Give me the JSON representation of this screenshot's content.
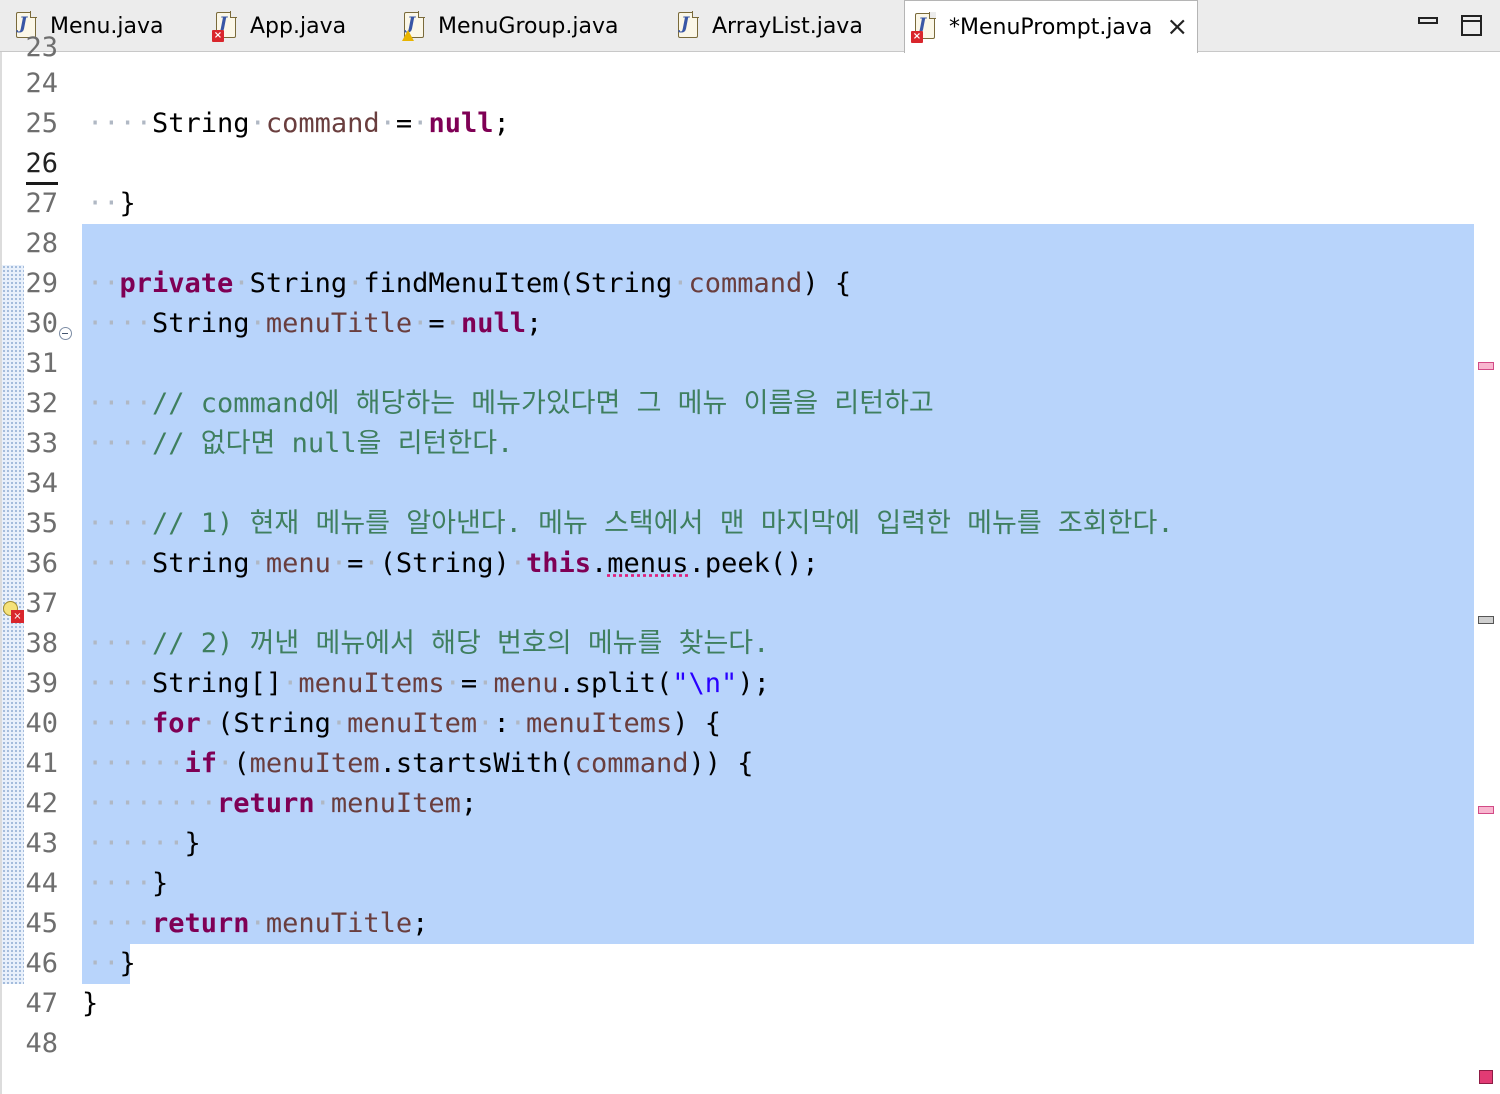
{
  "tabs": [
    {
      "label": "Menu.java",
      "status": "none",
      "active": false
    },
    {
      "label": "App.java",
      "status": "error",
      "active": false
    },
    {
      "label": "MenuGroup.java",
      "status": "warning",
      "active": false
    },
    {
      "label": "ArrayList.java",
      "status": "none",
      "active": false
    },
    {
      "label": "*MenuPrompt.java",
      "status": "error",
      "active": true
    }
  ],
  "window_controls": {
    "minimize_icon": "minimize-icon",
    "maximize_icon": "maximize-icon",
    "close_tab_glyph": "×"
  },
  "editor": {
    "current_line": "26",
    "lines": [
      {
        "n": "23",
        "partial": true
      },
      {
        "n": "24"
      },
      {
        "n": "25"
      },
      {
        "n": "26"
      },
      {
        "n": "27"
      },
      {
        "n": "28"
      },
      {
        "n": "29"
      },
      {
        "n": "30"
      },
      {
        "n": "31"
      },
      {
        "n": "32"
      },
      {
        "n": "33"
      },
      {
        "n": "34"
      },
      {
        "n": "35"
      },
      {
        "n": "36"
      },
      {
        "n": "37"
      },
      {
        "n": "38"
      },
      {
        "n": "39"
      },
      {
        "n": "40"
      },
      {
        "n": "41"
      },
      {
        "n": "42"
      },
      {
        "n": "43"
      },
      {
        "n": "44"
      },
      {
        "n": "45"
      },
      {
        "n": "46"
      },
      {
        "n": "47"
      },
      {
        "n": "48"
      }
    ],
    "code": {
      "l25": {
        "type": "String",
        "name": "command",
        "op": "=",
        "kw": "null",
        "end": ";"
      },
      "l27": "}",
      "l29": {
        "kw": "private",
        "type": "String",
        "method": "findMenuItem(String",
        "param": "command",
        "end": ") {"
      },
      "l30": {
        "type": "String",
        "name": "menuTitle",
        "op": "=",
        "kw": "null",
        "end": ";"
      },
      "l32": "// command에 해당하는 메뉴가있다면 그 메뉴 이름을 리턴하고",
      "l33": "// 없다면 null을 리턴한다.",
      "l35": "// 1) 현재 메뉴를 알아낸다. 메뉴 스택에서 맨 마지막에 입력한 메뉴를 조회한다.",
      "l36": {
        "type": "String",
        "name": "menu",
        "op": "=",
        "cast": "(String)",
        "kw": "this",
        "field": "menus",
        "call": ".peek();"
      },
      "l38": "// 2) 꺼낸 메뉴에서 해당 번호의 메뉴를 찾는다.",
      "l39": {
        "type": "String[]",
        "name": "menuItems",
        "op": "=",
        "recv": "menu",
        "call": ".split(",
        "str": "\"\\n\"",
        "end": ");"
      },
      "l40": {
        "kw": "for",
        "open": "(String",
        "name": "menuItem",
        "sep": ":",
        "iter": "menuItems",
        "end": ") {"
      },
      "l41": {
        "kw": "if",
        "open": "(",
        "recv": "menuItem",
        "call": ".startsWith(",
        "arg": "command",
        "end": ")) {"
      },
      "l42": {
        "kw": "return",
        "name": "menuItem",
        "end": ";"
      },
      "l43": "}",
      "l44": "}",
      "l45": {
        "kw": "return",
        "name": "menuTitle",
        "end": ";"
      },
      "l46": "}",
      "l47": "}"
    }
  },
  "colors": {
    "keyword": "#7f0055",
    "local_var": "#6a3e3e",
    "comment": "#3f7f5f",
    "string": "#2a00ff",
    "selection": "#b8d4fb"
  }
}
